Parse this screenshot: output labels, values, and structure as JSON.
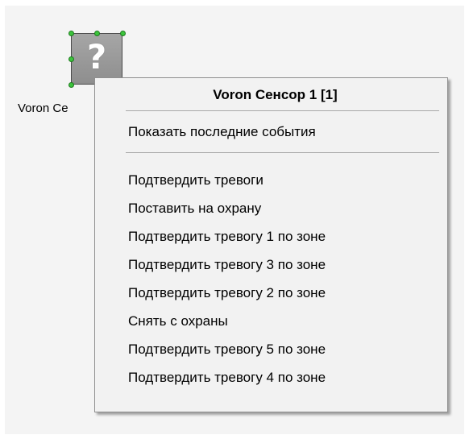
{
  "sensor": {
    "label": "Voron Ce",
    "icon": "question-mark-icon",
    "glyph": "?",
    "handle_color": "#3cc43c"
  },
  "context_menu": {
    "title": "Voron Сенсор 1 [1]",
    "primary_items": [
      {
        "label": "Показать последние события"
      }
    ],
    "items": [
      {
        "label": "Подтвердить тревоги"
      },
      {
        "label": "Поставить на охрану"
      },
      {
        "label": "Подтвердить тревогу 1 по зоне"
      },
      {
        "label": "Подтвердить тревогу 3 по зоне"
      },
      {
        "label": "Подтвердить тревогу 2 по зоне"
      },
      {
        "label": "Снять с охраны"
      },
      {
        "label": "Подтвердить тревогу 5 по зоне"
      },
      {
        "label": "Подтвердить тревогу 4 по зоне"
      }
    ]
  }
}
